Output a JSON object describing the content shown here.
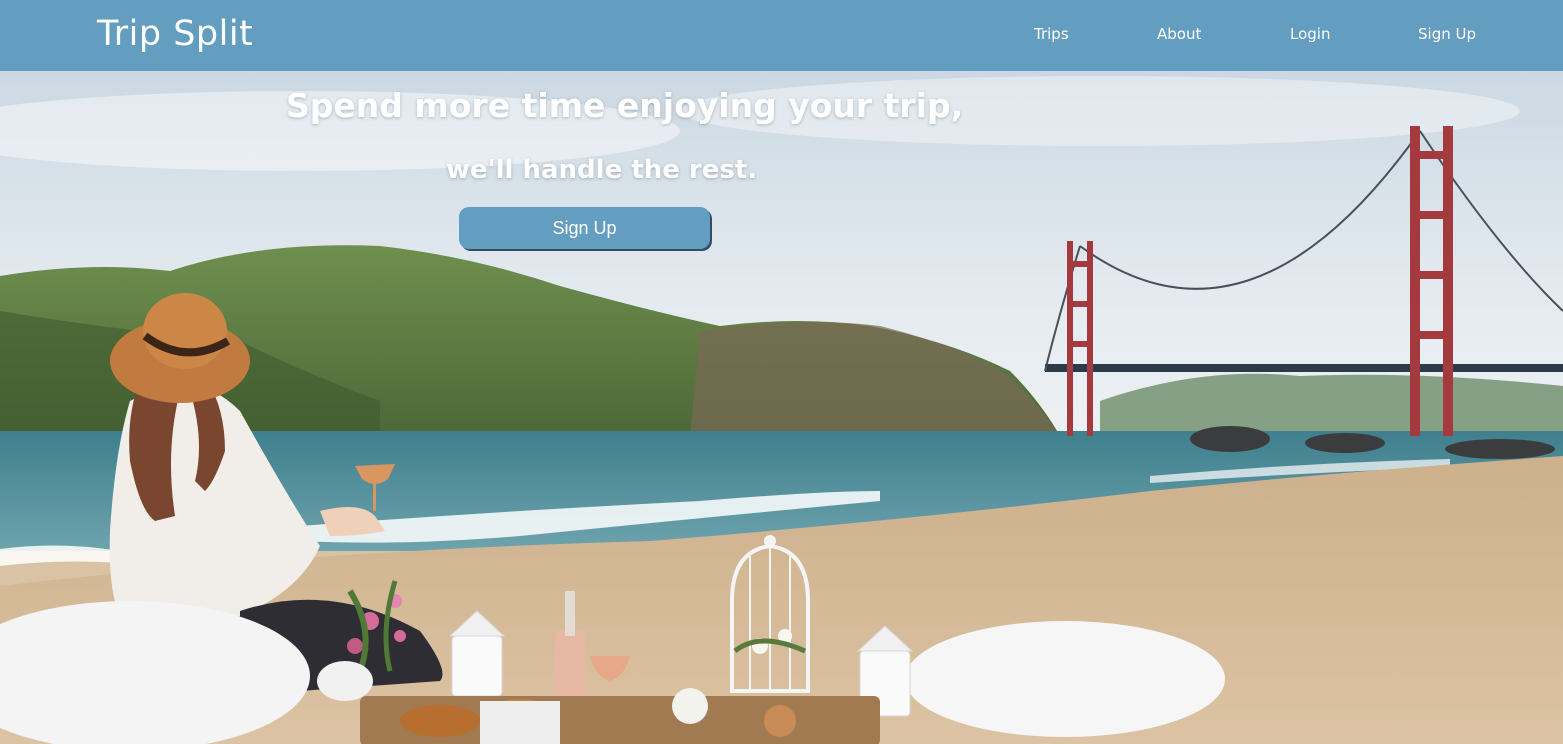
{
  "brand": {
    "title": "Trip Split"
  },
  "nav": {
    "items": [
      {
        "label": "Trips"
      },
      {
        "label": "About"
      },
      {
        "label": "Login"
      },
      {
        "label": "Sign Up"
      }
    ]
  },
  "hero": {
    "headline_line1": "Spend more time enjoying your trip,",
    "headline_line2": "we'll handle the rest.",
    "cta_label": "Sign Up"
  },
  "colors": {
    "accent": "#639ec1",
    "text_on_accent": "#ffffff"
  }
}
